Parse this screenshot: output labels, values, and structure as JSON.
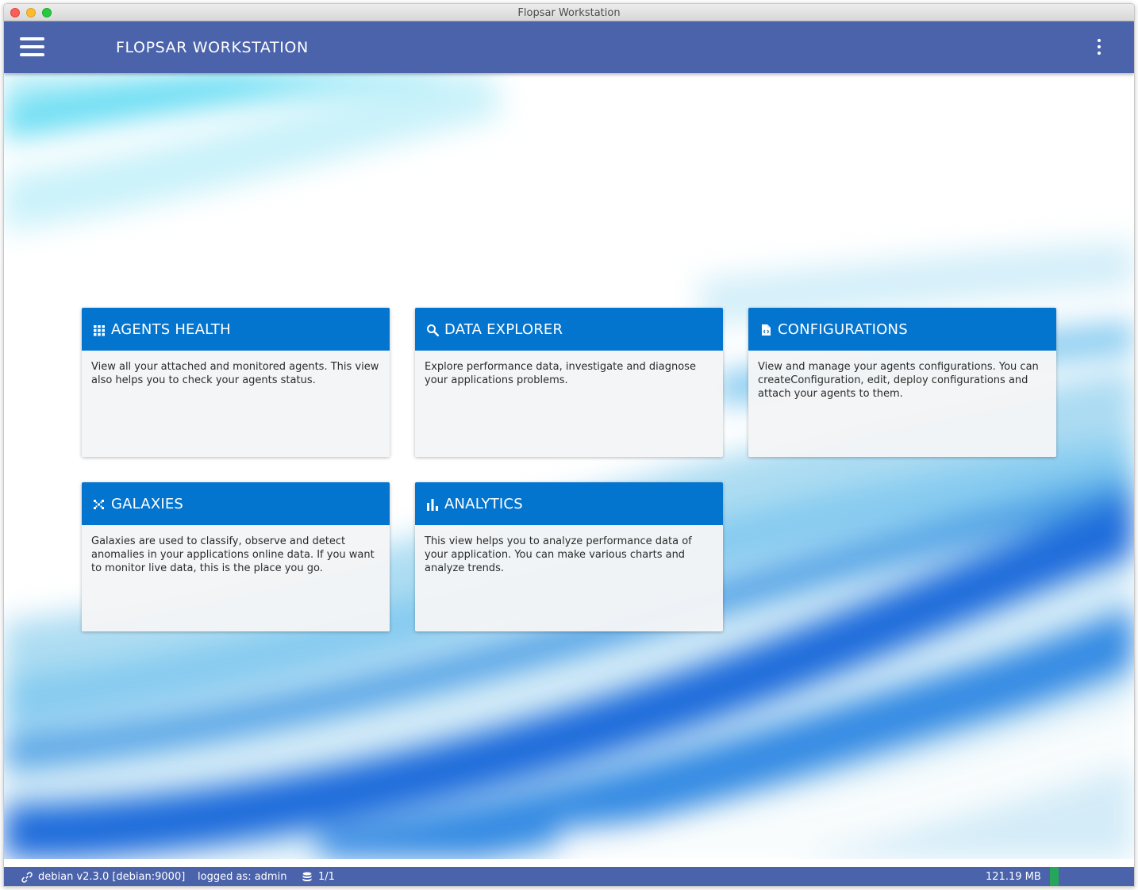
{
  "window": {
    "title": "Flopsar Workstation"
  },
  "appbar": {
    "title": "FLOPSAR WORKSTATION"
  },
  "cards": [
    {
      "id": "agents-health",
      "icon": "grid-icon",
      "title": "AGENTS HEALTH",
      "description": "View all your attached and monitored agents. This view also helps you to check your agents status."
    },
    {
      "id": "data-explorer",
      "icon": "search-icon",
      "title": "DATA EXPLORER",
      "description": "Explore performance data, investigate and diagnose your applications problems."
    },
    {
      "id": "configurations",
      "icon": "code-file-icon",
      "title": "CONFIGURATIONS",
      "description": "View and manage your agents configurations. You can createConfiguration, edit, deploy configurations and attach your agents to them."
    },
    {
      "id": "galaxies",
      "icon": "scatter-icon",
      "title": "GALAXIES",
      "description": "Galaxies are used to classify, observe and detect anomalies in your applications online data. If you want to monitor live data, this is the place you go."
    },
    {
      "id": "analytics",
      "icon": "bar-chart-icon",
      "title": "ANALYTICS",
      "description": "This view helps you to analyze performance data of your application. You can make various charts and analyze trends."
    }
  ],
  "statusbar": {
    "connection": "debian v2.3.0 [debian:9000]",
    "user": "logged as: admin",
    "databases": "1/1",
    "memory": "121.19 MB"
  },
  "colors": {
    "appbar": "#4a63ab",
    "card_header": "#0475cf",
    "memory_indicator": "#26a65b"
  }
}
